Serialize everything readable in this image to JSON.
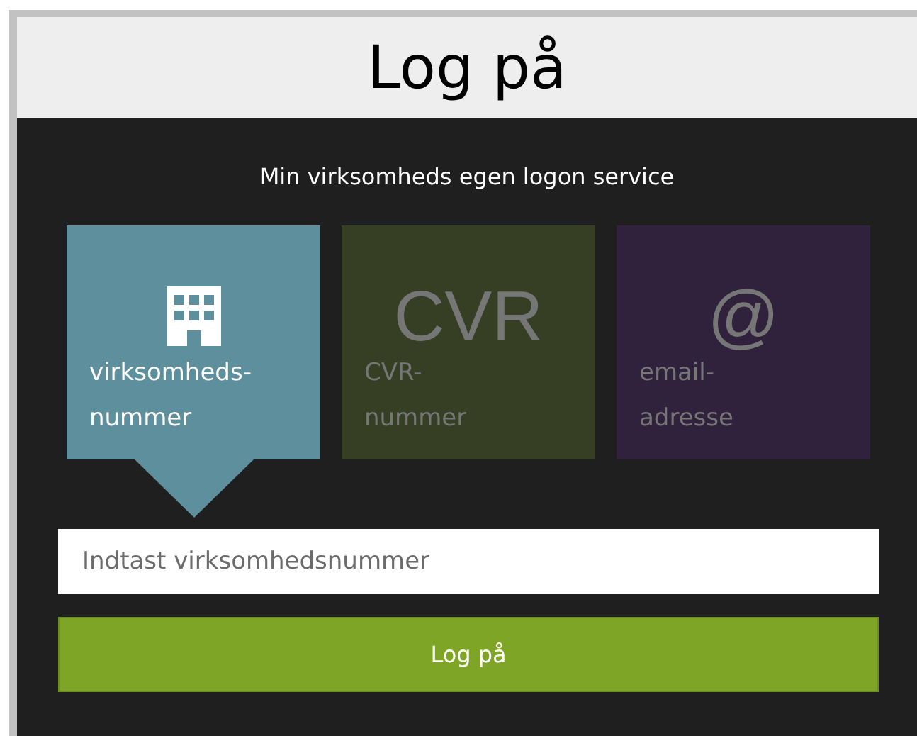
{
  "header": {
    "title": "Log på"
  },
  "subtitle": "Min virksomheds egen logon service",
  "tiles": [
    {
      "kind": "icon",
      "label_lines": [
        "virksomheds-",
        "nummer"
      ],
      "color": "#5e8f9c",
      "selected": true
    },
    {
      "kind": "glyph",
      "glyph": "CVR",
      "label_lines": [
        "CVR-",
        "nummer"
      ],
      "color": "#363f23",
      "selected": false
    },
    {
      "kind": "glyph",
      "glyph": "@",
      "label_lines": [
        "email-",
        "adresse"
      ],
      "color": "#30213c",
      "selected": false
    }
  ],
  "input": {
    "placeholder": "Indtast virksomhedsnummer"
  },
  "button": "Log på"
}
